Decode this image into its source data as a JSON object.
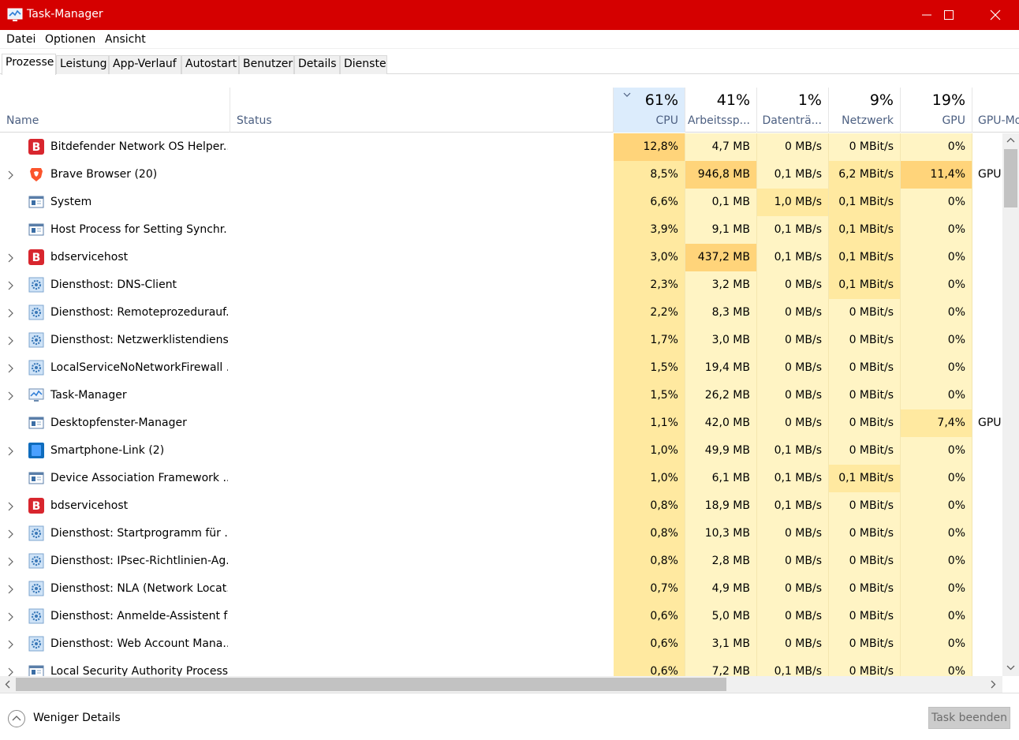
{
  "window": {
    "title": "Task-Manager"
  },
  "menu": [
    "Datei",
    "Optionen",
    "Ansicht"
  ],
  "tabs": [
    "Prozesse",
    "Leistung",
    "App-Verlauf",
    "Autostart",
    "Benutzer",
    "Details",
    "Dienste"
  ],
  "active_tab": "Prozesse",
  "columns": {
    "name": "Name",
    "status": "Status",
    "cpu": {
      "pct": "61%",
      "label": "CPU"
    },
    "mem": {
      "pct": "41%",
      "label": "Arbeitssp..."
    },
    "disk": {
      "pct": "1%",
      "label": "Datenträ..."
    },
    "net": {
      "pct": "9%",
      "label": "Netzwerk"
    },
    "gpu": {
      "pct": "19%",
      "label": "GPU"
    },
    "gpu_engine": {
      "label": "GPU-Mo"
    }
  },
  "processes": [
    {
      "name": "Bitdefender Network OS Helper...",
      "icon": "bitdefender-icon",
      "expand": false,
      "cpu": "12,8%",
      "mem": "4,7 MB",
      "disk": "0 MB/s",
      "net": "0 MBit/s",
      "gpu": "0%",
      "gpu_engine": ""
    },
    {
      "name": "Brave Browser (20)",
      "icon": "brave-icon",
      "expand": true,
      "cpu": "8,5%",
      "mem": "946,8 MB",
      "disk": "0,1 MB/s",
      "net": "6,2 MBit/s",
      "gpu": "11,4%",
      "gpu_engine": "GPU"
    },
    {
      "name": "System",
      "icon": "window-icon",
      "expand": false,
      "cpu": "6,6%",
      "mem": "0,1 MB",
      "disk": "1,0 MB/s",
      "net": "0,1 MBit/s",
      "gpu": "0%",
      "gpu_engine": ""
    },
    {
      "name": "Host Process for Setting Synchr...",
      "icon": "window-icon",
      "expand": false,
      "cpu": "3,9%",
      "mem": "9,1 MB",
      "disk": "0,1 MB/s",
      "net": "0,1 MBit/s",
      "gpu": "0%",
      "gpu_engine": ""
    },
    {
      "name": "bdservicehost",
      "icon": "bitdefender-icon",
      "expand": true,
      "cpu": "3,0%",
      "mem": "437,2 MB",
      "disk": "0,1 MB/s",
      "net": "0,1 MBit/s",
      "gpu": "0%",
      "gpu_engine": ""
    },
    {
      "name": "Diensthost: DNS-Client",
      "icon": "gear-icon",
      "expand": true,
      "cpu": "2,3%",
      "mem": "3,2 MB",
      "disk": "0 MB/s",
      "net": "0,1 MBit/s",
      "gpu": "0%",
      "gpu_engine": ""
    },
    {
      "name": "Diensthost: Remoteprozedurauf...",
      "icon": "gear-icon",
      "expand": true,
      "cpu": "2,2%",
      "mem": "8,3 MB",
      "disk": "0 MB/s",
      "net": "0 MBit/s",
      "gpu": "0%",
      "gpu_engine": ""
    },
    {
      "name": "Diensthost: Netzwerklistendienst",
      "icon": "gear-icon",
      "expand": true,
      "cpu": "1,7%",
      "mem": "3,0 MB",
      "disk": "0 MB/s",
      "net": "0 MBit/s",
      "gpu": "0%",
      "gpu_engine": ""
    },
    {
      "name": "LocalServiceNoNetworkFirewall ...",
      "icon": "gear-icon",
      "expand": true,
      "cpu": "1,5%",
      "mem": "19,4 MB",
      "disk": "0 MB/s",
      "net": "0 MBit/s",
      "gpu": "0%",
      "gpu_engine": ""
    },
    {
      "name": "Task-Manager",
      "icon": "taskmanager-icon",
      "expand": true,
      "cpu": "1,5%",
      "mem": "26,2 MB",
      "disk": "0 MB/s",
      "net": "0 MBit/s",
      "gpu": "0%",
      "gpu_engine": ""
    },
    {
      "name": "Desktopfenster-Manager",
      "icon": "window-icon",
      "expand": false,
      "cpu": "1,1%",
      "mem": "42,0 MB",
      "disk": "0 MB/s",
      "net": "0 MBit/s",
      "gpu": "7,4%",
      "gpu_engine": "GPU"
    },
    {
      "name": "Smartphone-Link (2)",
      "icon": "phonelink-icon",
      "expand": true,
      "cpu": "1,0%",
      "mem": "49,9 MB",
      "disk": "0,1 MB/s",
      "net": "0 MBit/s",
      "gpu": "0%",
      "gpu_engine": ""
    },
    {
      "name": "Device Association Framework ...",
      "icon": "window-icon",
      "expand": false,
      "cpu": "1,0%",
      "mem": "6,1 MB",
      "disk": "0,1 MB/s",
      "net": "0,1 MBit/s",
      "gpu": "0%",
      "gpu_engine": ""
    },
    {
      "name": "bdservicehost",
      "icon": "bitdefender-icon",
      "expand": true,
      "cpu": "0,8%",
      "mem": "18,9 MB",
      "disk": "0,1 MB/s",
      "net": "0 MBit/s",
      "gpu": "0%",
      "gpu_engine": ""
    },
    {
      "name": "Diensthost: Startprogramm für ...",
      "icon": "gear-icon",
      "expand": true,
      "cpu": "0,8%",
      "mem": "10,3 MB",
      "disk": "0 MB/s",
      "net": "0 MBit/s",
      "gpu": "0%",
      "gpu_engine": ""
    },
    {
      "name": "Diensthost: IPsec-Richtlinien-Ag...",
      "icon": "gear-icon",
      "expand": true,
      "cpu": "0,8%",
      "mem": "2,8 MB",
      "disk": "0 MB/s",
      "net": "0 MBit/s",
      "gpu": "0%",
      "gpu_engine": ""
    },
    {
      "name": "Diensthost: NLA (Network Locat...",
      "icon": "gear-icon",
      "expand": true,
      "cpu": "0,7%",
      "mem": "4,9 MB",
      "disk": "0 MB/s",
      "net": "0 MBit/s",
      "gpu": "0%",
      "gpu_engine": ""
    },
    {
      "name": "Diensthost: Anmelde-Assistent f...",
      "icon": "gear-icon",
      "expand": true,
      "cpu": "0,6%",
      "mem": "5,0 MB",
      "disk": "0 MB/s",
      "net": "0 MBit/s",
      "gpu": "0%",
      "gpu_engine": ""
    },
    {
      "name": "Diensthost: Web Account Mana...",
      "icon": "gear-icon",
      "expand": true,
      "cpu": "0,6%",
      "mem": "3,1 MB",
      "disk": "0 MB/s",
      "net": "0 MBit/s",
      "gpu": "0%",
      "gpu_engine": ""
    },
    {
      "name": "Local Security Authority Process ...",
      "icon": "window-icon",
      "expand": true,
      "cpu": "0,6%",
      "mem": "7,2 MB",
      "disk": "0,1 MB/s",
      "net": "0 MBit/s",
      "gpu": "0%",
      "gpu_engine": ""
    }
  ],
  "footer": {
    "fewer_details": "Weniger Details",
    "end_task": "Task beenden"
  },
  "colors": {
    "titlebar": "#d50000",
    "heat_low": "#fff4c4",
    "heat_mid": "#ffe9a0",
    "heat_high": "#ffd47a",
    "sorted_header": "#dcecfc"
  }
}
